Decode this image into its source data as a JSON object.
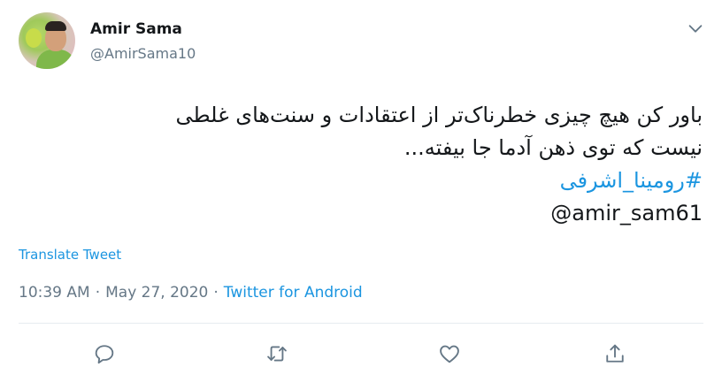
{
  "author": {
    "display_name": "Amir Sama",
    "handle": "@AmirSama10"
  },
  "tweet": {
    "lines": [
      "باور کن هیچ چیزی خطرناک‌تر از اعتقادات و سنت‌های غلطی",
      "نیست که توی ذهن آدما جا بیفته..."
    ],
    "hashtag": "#رومینا_اشرفی",
    "mention": "amir_sam61@"
  },
  "translate_label": "Translate Tweet",
  "meta": {
    "time": "10:39 AM",
    "separator": "·",
    "date": "May 27, 2020",
    "source": "Twitter for Android"
  },
  "colors": {
    "link": "#1b95e0",
    "secondary": "#657786",
    "text": "#14171a"
  },
  "icons": {
    "more": "chevron-down-icon",
    "reply": "reply-icon",
    "retweet": "retweet-icon",
    "like": "like-icon",
    "share": "share-icon"
  }
}
